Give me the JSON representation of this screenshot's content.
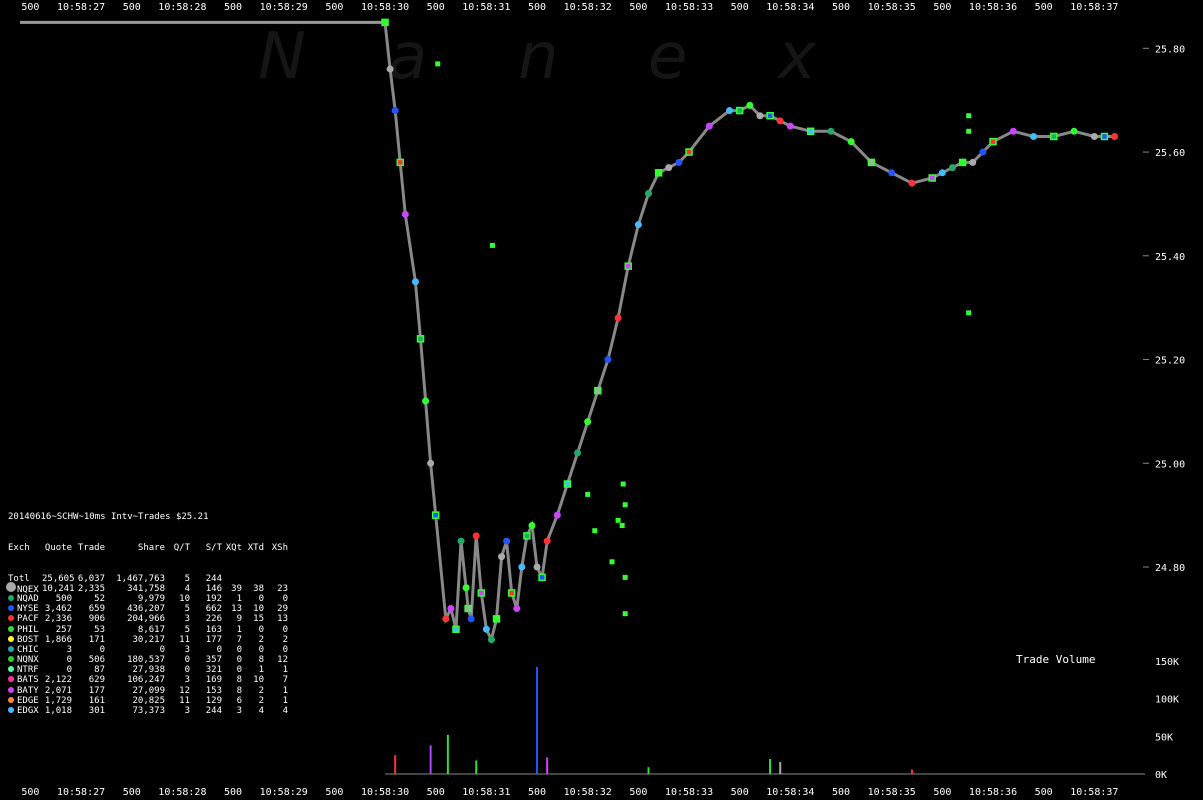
{
  "watermark": "Nanex",
  "chart_data": {
    "type": "scatter",
    "title": "20140616~SCHW~10ms Intv~Trades $25.21",
    "y_ticks": [
      "25.80",
      "25.60",
      "25.40",
      "25.20",
      "25.00",
      "24.80"
    ],
    "y_values": [
      25.8,
      25.6,
      25.4,
      25.2,
      25.0,
      24.8
    ],
    "ylim": [
      24.64,
      25.87
    ],
    "x_labels": [
      "500",
      "10:58:27",
      "500",
      "10:58:28",
      "500",
      "10:58:29",
      "500",
      "10:58:30",
      "500",
      "10:58:31",
      "500",
      "10:58:32",
      "500",
      "10:58:33",
      "500",
      "10:58:34",
      "500",
      "10:58:35",
      "500",
      "10:58:36",
      "500",
      "10:58:37"
    ],
    "x_seconds": [
      26.5,
      27,
      27.5,
      28,
      28.5,
      29,
      29.5,
      30,
      30.5,
      31,
      31.5,
      32,
      32.5,
      33,
      33.5,
      34,
      34.5,
      35,
      35.5,
      36,
      36.5,
      37
    ],
    "xlim": [
      26.2,
      37.5
    ],
    "price_series": {
      "name": "Trades",
      "x": [
        30.0,
        30.05,
        30.1,
        30.15,
        30.2,
        30.3,
        30.35,
        30.4,
        30.45,
        30.5,
        30.6,
        30.65,
        30.7,
        30.75,
        30.8,
        30.82,
        30.85,
        30.9,
        30.95,
        31.0,
        31.05,
        31.1,
        31.15,
        31.2,
        31.25,
        31.3,
        31.35,
        31.4,
        31.45,
        31.5,
        31.55,
        31.6,
        31.7,
        31.8,
        31.9,
        32.0,
        32.1,
        32.2,
        32.3,
        32.4,
        32.5,
        32.6,
        32.7,
        32.8,
        32.9,
        33.0,
        33.2,
        33.4,
        33.5,
        33.6,
        33.7,
        33.8,
        33.9,
        34.0,
        34.2,
        34.4,
        34.6,
        34.8,
        35.0,
        35.2,
        35.4,
        35.5,
        35.6,
        35.7,
        35.8,
        35.9,
        36.0,
        36.2,
        36.4,
        36.6,
        36.8,
        37.0,
        37.1,
        37.2
      ],
      "y": [
        25.85,
        25.76,
        25.68,
        25.58,
        25.48,
        25.35,
        25.24,
        25.12,
        25.0,
        24.9,
        24.7,
        24.72,
        24.68,
        24.85,
        24.76,
        24.72,
        24.7,
        24.86,
        24.75,
        24.68,
        24.66,
        24.7,
        24.82,
        24.85,
        24.75,
        24.72,
        24.8,
        24.86,
        24.88,
        24.8,
        24.78,
        24.85,
        24.9,
        24.96,
        25.02,
        25.08,
        25.14,
        25.2,
        25.28,
        25.38,
        25.46,
        25.52,
        25.56,
        25.57,
        25.58,
        25.6,
        25.65,
        25.68,
        25.68,
        25.69,
        25.67,
        25.67,
        25.66,
        25.65,
        25.64,
        25.64,
        25.62,
        25.58,
        25.56,
        25.54,
        25.55,
        25.56,
        25.57,
        25.58,
        25.58,
        25.6,
        25.62,
        25.64,
        25.63,
        25.63,
        25.64,
        25.63,
        25.63,
        25.63
      ]
    },
    "outliers": [
      {
        "x": 35.76,
        "y": 25.67
      },
      {
        "x": 35.76,
        "y": 25.64
      },
      {
        "x": 35.76,
        "y": 25.29
      },
      {
        "x": 32.0,
        "y": 24.94
      },
      {
        "x": 32.07,
        "y": 24.87
      },
      {
        "x": 32.35,
        "y": 24.96
      },
      {
        "x": 32.37,
        "y": 24.92
      },
      {
        "x": 32.34,
        "y": 24.88
      },
      {
        "x": 32.3,
        "y": 24.89
      },
      {
        "x": 32.24,
        "y": 24.81
      },
      {
        "x": 32.37,
        "y": 24.78
      },
      {
        "x": 32.37,
        "y": 24.71
      },
      {
        "x": 30.52,
        "y": 25.77
      },
      {
        "x": 31.06,
        "y": 25.42
      }
    ],
    "ref_line": {
      "x_start": 26.2,
      "x_end": 30.0,
      "y": 25.85
    },
    "volume": {
      "title": "Trade Volume",
      "y_ticks": [
        "150K",
        "100K",
        "50K",
        "0K"
      ],
      "y_values": [
        150000,
        100000,
        50000,
        0
      ],
      "spikes": [
        {
          "x": 31.5,
          "v": 142000,
          "color": "#2255ff"
        },
        {
          "x": 30.62,
          "v": 52000,
          "color": "#33dd33"
        },
        {
          "x": 30.45,
          "v": 38000,
          "color": "#aa44ff"
        },
        {
          "x": 30.1,
          "v": 25000,
          "color": "#ff3333"
        },
        {
          "x": 30.9,
          "v": 18000,
          "color": "#33dd33"
        },
        {
          "x": 31.6,
          "v": 22000,
          "color": "#cc44ff"
        },
        {
          "x": 33.8,
          "v": 20000,
          "color": "#33dd33"
        },
        {
          "x": 33.9,
          "v": 16000,
          "color": "#aaaaaa"
        },
        {
          "x": 32.6,
          "v": 9000,
          "color": "#33dd33"
        },
        {
          "x": 35.2,
          "v": 6000,
          "color": "#ff3333"
        }
      ]
    },
    "legend": {
      "header": [
        "Exch",
        "Quote",
        "Trade",
        "Share",
        "Q/T",
        "S/T",
        "XQt",
        "XTd",
        "XSh"
      ],
      "rows": [
        {
          "cells": [
            "Totl",
            "25,605",
            "6,037",
            "1,467,763",
            "5",
            "244",
            "",
            "",
            ""
          ],
          "color": ""
        },
        {
          "cells": [
            "NQEX",
            "10,241",
            "2,335",
            "341,758",
            "4",
            "146",
            "39",
            "38",
            "23"
          ],
          "color": "#aaaaaa"
        },
        {
          "cells": [
            "NQAD",
            "500",
            "52",
            "9,979",
            "10",
            "192",
            "1",
            "0",
            "0"
          ],
          "color": "#22aa66"
        },
        {
          "cells": [
            "NYSE",
            "3,462",
            "659",
            "436,207",
            "5",
            "662",
            "13",
            "10",
            "29"
          ],
          "color": "#2255ff"
        },
        {
          "cells": [
            "PACF",
            "2,336",
            "906",
            "204,966",
            "3",
            "226",
            "9",
            "15",
            "13"
          ],
          "color": "#ff3333"
        },
        {
          "cells": [
            "PHIL",
            "257",
            "53",
            "8,617",
            "5",
            "163",
            "1",
            "0",
            "0"
          ],
          "color": "#33dd33"
        },
        {
          "cells": [
            "BOST",
            "1,866",
            "171",
            "30,217",
            "11",
            "177",
            "7",
            "2",
            "2"
          ],
          "color": "#ffff33"
        },
        {
          "cells": [
            "CHIC",
            "3",
            "0",
            "0",
            "3",
            "0",
            "0",
            "0",
            "0"
          ],
          "color": "#22aaaa"
        },
        {
          "cells": [
            "NQNX",
            "0",
            "506",
            "180,537",
            "0",
            "357",
            "0",
            "8",
            "12"
          ],
          "color": "#33cc33"
        },
        {
          "cells": [
            "NTRF",
            "0",
            "87",
            "27,938",
            "0",
            "321",
            "0",
            "1",
            "1"
          ],
          "color": "#55ffaa"
        },
        {
          "cells": [
            "BATS",
            "2,122",
            "629",
            "106,247",
            "3",
            "169",
            "8",
            "10",
            "7"
          ],
          "color": "#ff33aa"
        },
        {
          "cells": [
            "BATY",
            "2,071",
            "177",
            "27,099",
            "12",
            "153",
            "8",
            "2",
            "1"
          ],
          "color": "#cc44ff"
        },
        {
          "cells": [
            "EDGE",
            "1,729",
            "161",
            "20,825",
            "11",
            "129",
            "6",
            "2",
            "1"
          ],
          "color": "#ff8833"
        },
        {
          "cells": [
            "EDGX",
            "1,018",
            "301",
            "73,373",
            "3",
            "244",
            "3",
            "4",
            "4"
          ],
          "color": "#44bbff"
        }
      ]
    }
  }
}
